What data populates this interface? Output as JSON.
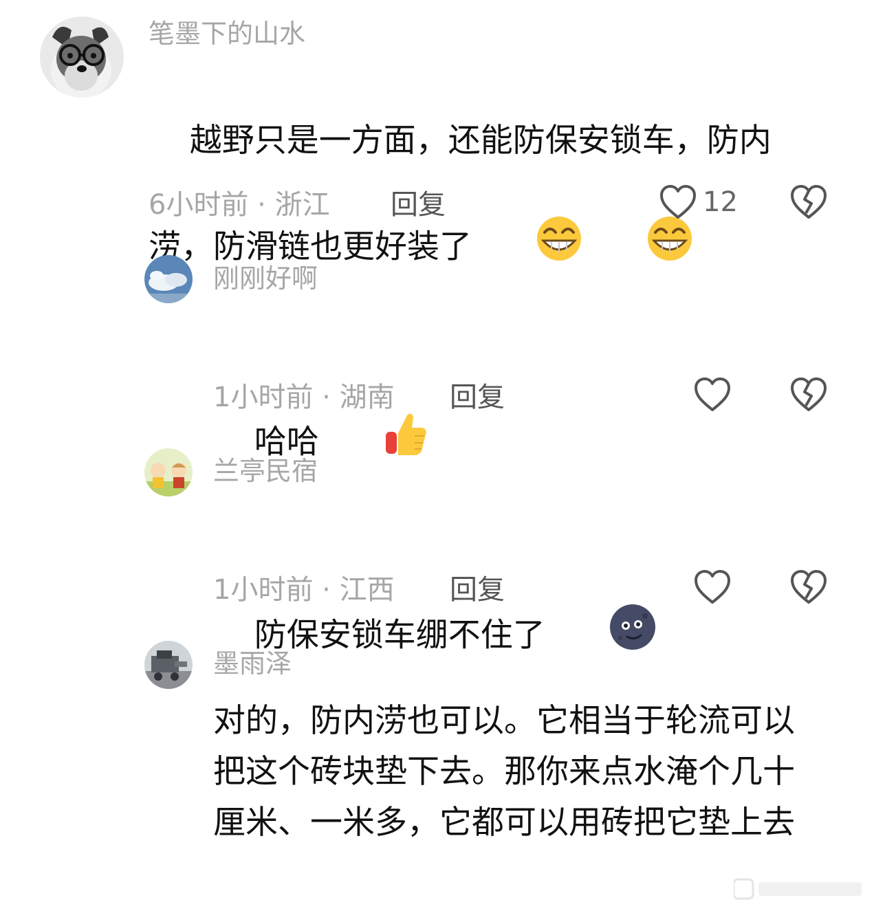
{
  "comments": [
    {
      "username": "笔墨下的山水",
      "text": "越野只是一方面，还能防保安锁车，防内涝，防滑链也更好装了",
      "emojis": [
        "grinning-face-icon",
        "grinning-face-icon"
      ],
      "time_location": "6小时前 · 浙江",
      "reply_label": "回复",
      "like_count": "12"
    },
    {
      "username": "刚刚好啊",
      "text": "哈哈",
      "emojis": [
        "thumbs-up-icon"
      ],
      "time_location": "1小时前 · 湖南",
      "reply_label": "回复"
    },
    {
      "username": "兰亭民宿",
      "text": "防保安锁车绷不住了",
      "emojis": [
        "new-moon-face-icon"
      ],
      "time_location": "1小时前 · 江西",
      "reply_label": "回复"
    },
    {
      "username": "墨雨泽",
      "text": "对的，防内涝也可以。它相当于轮流可以把这个砖块垫下去。那你来点水淹个几十厘米、一米多，它都可以用砖把它垫上去"
    }
  ],
  "colors": {
    "meta_gray": "#a6a6a6",
    "icon_gray": "#555555",
    "text_dark": "#111111"
  }
}
